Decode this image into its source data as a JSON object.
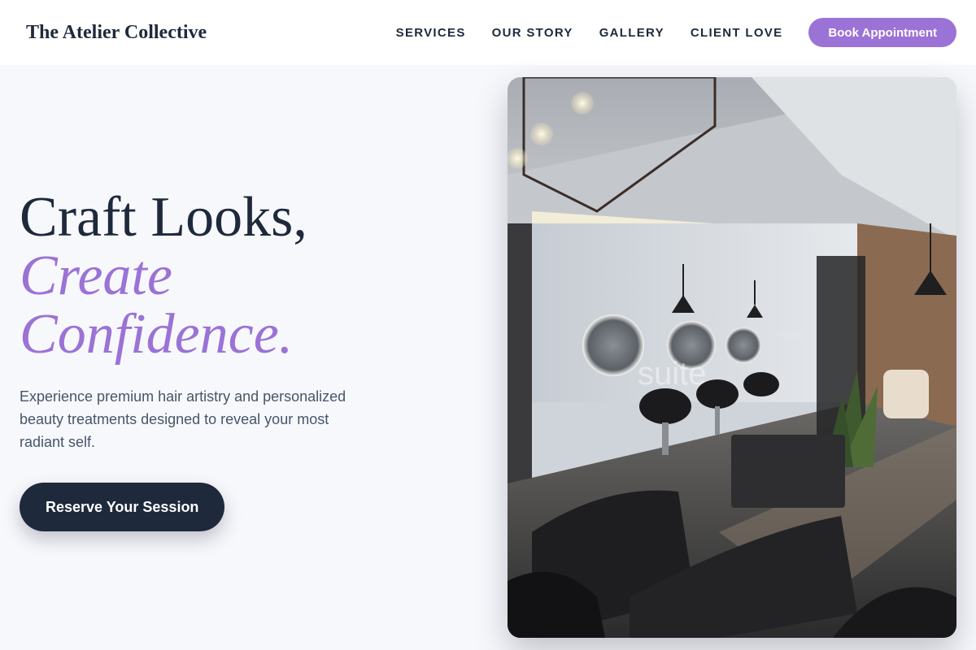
{
  "brand": "The Atelier Collective",
  "nav": {
    "items": [
      "SERVICES",
      "OUR STORY",
      "GALLERY",
      "CLIENT LOVE"
    ],
    "book_label": "Book Appointment"
  },
  "hero": {
    "line1": "Craft Looks,",
    "line2": "Create",
    "line3": "Confidence.",
    "description": "Experience premium hair artistry and personalized beauty treatments designed to reveal your most radiant self.",
    "cta_label": "Reserve Your Session"
  },
  "photo": {
    "watermark": "suite",
    "wall_sign": "beauty"
  },
  "colors": {
    "accent": "#9b72d6",
    "dark": "#1e293b",
    "background": "#f7f8fc"
  }
}
